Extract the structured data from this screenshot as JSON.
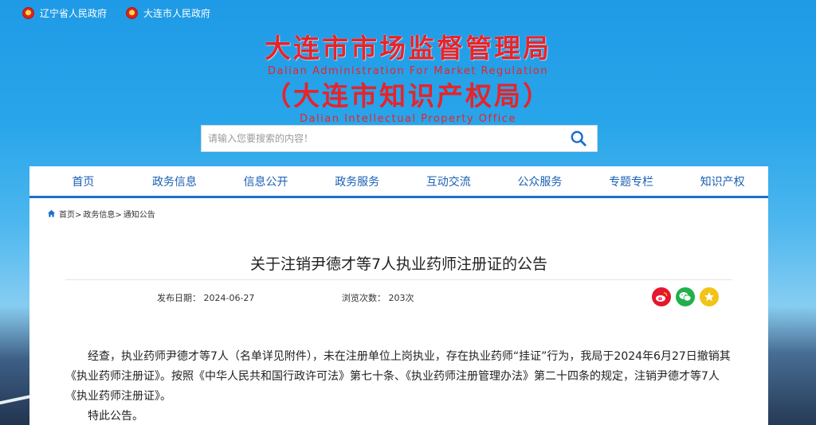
{
  "topbar": {
    "links": [
      {
        "label": "辽宁省人民政府"
      },
      {
        "label": "大连市人民政府"
      }
    ]
  },
  "header": {
    "title_cn": "大连市市场监督管理局",
    "title_en": "Dalian Administration For Market Regulation",
    "title_cn2": "（大连市知识产权局）",
    "title_en2": "Dalian Intellectual Property Office"
  },
  "search": {
    "placeholder": "请输入您要搜索的内容！",
    "icon": "search-icon"
  },
  "nav": {
    "items": [
      {
        "label": "首页"
      },
      {
        "label": "政务信息"
      },
      {
        "label": "信息公开"
      },
      {
        "label": "政务服务"
      },
      {
        "label": "互动交流"
      },
      {
        "label": "公众服务"
      },
      {
        "label": "专题专栏"
      },
      {
        "label": "知识产权"
      }
    ],
    "accent": "#1a6fcc"
  },
  "breadcrumb": {
    "items": [
      "首页>",
      "政务信息>",
      "通知公告"
    ]
  },
  "article": {
    "title": "关于注销尹德才等7人执业药师注册证的公告",
    "date_label": "发布日期：",
    "date": "2024-06-27",
    "views_label": "浏览次数：",
    "views": "203次",
    "paragraph1": "经查，执业药师尹德才等7人（名单详见附件），未在注册单位上岗执业，存在执业药师“挂证”行为，我局于2024年6月27日撤销其《执业药师注册证》。按照《中华人民共和国行政许可法》第七十条、《执业药师注册管理办法》第二十四条的规定，注销尹德才等7人《执业药师注册证》。",
    "paragraph2": "特此公告。"
  },
  "share": [
    "weibo-icon",
    "wechat-icon",
    "favorite-icon"
  ],
  "colors": {
    "title_red": "#e8232a",
    "link_blue": "#1a5fb4"
  }
}
